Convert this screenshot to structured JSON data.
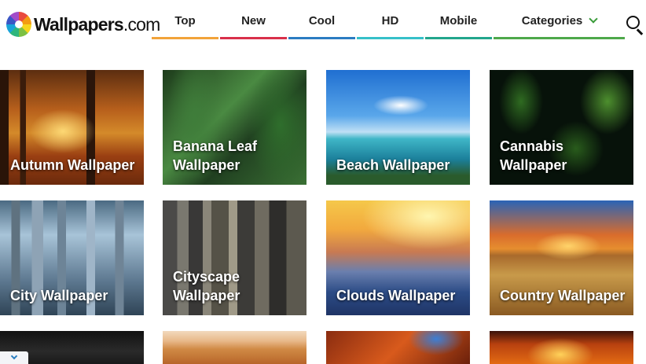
{
  "brand": {
    "name_main": "Wallpapers",
    "name_suffix": ".com"
  },
  "nav": [
    {
      "label": "Top",
      "underline": "#f2a33a"
    },
    {
      "label": "New",
      "underline": "#d9304a"
    },
    {
      "label": "Cool",
      "underline": "#2b7cc2"
    },
    {
      "label": "HD",
      "underline": "#35c0c9"
    },
    {
      "label": "Mobile",
      "underline": "#22a68c"
    },
    {
      "label": "Categories",
      "underline": "#4ea84a"
    }
  ],
  "search_icon": "search-icon",
  "categories": [
    {
      "title": "Autumn Wallpaper"
    },
    {
      "title": "Banana Leaf Wallpaper"
    },
    {
      "title": "Beach Wallpaper"
    },
    {
      "title": "Cannabis Wallpaper"
    },
    {
      "title": "City Wallpaper"
    },
    {
      "title": "Cityscape Wallpaper"
    },
    {
      "title": "Clouds Wallpaper"
    },
    {
      "title": "Country Wallpaper"
    }
  ],
  "scroll_button_icon": "chevron-down-icon"
}
